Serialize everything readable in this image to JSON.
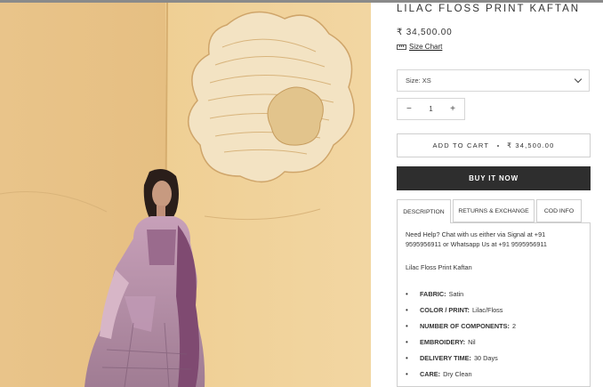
{
  "product": {
    "title": "LILAC FLOSS PRINT KAFTAN",
    "price": "₹ 34,500.00",
    "size_chart_label": "Size Chart"
  },
  "size_select": {
    "value": "Size: XS"
  },
  "quantity": {
    "minus": "−",
    "value": "1",
    "plus": "+"
  },
  "add_to_cart": {
    "label": "ADD TO CART",
    "price": "₹ 34,500.00"
  },
  "buy_now": {
    "label": "BUY IT NOW"
  },
  "tabs": [
    {
      "label": "DESCRIPTION"
    },
    {
      "label": "RETURNS & EXCHANGE"
    },
    {
      "label": "COD INFO"
    }
  ],
  "description": {
    "help_text": "Need Help? Chat with us either via Signal at +91 9595956911 or Whatsapp Us at +91 9595956911",
    "product_name": "Lilac Floss Print Kaftan",
    "specs": [
      {
        "label": "FABRIC:",
        "value": "Satin"
      },
      {
        "label": "COLOR / PRINT:",
        "value": "Lilac/Floss"
      },
      {
        "label": "NUMBER OF COMPONENTS:",
        "value": "2"
      },
      {
        "label": "EMBROIDERY:",
        "value": "Nil"
      },
      {
        "label": "DELIVERY TIME:",
        "value": "30 Days"
      },
      {
        "label": "CARE:",
        "value": "Dry Clean"
      }
    ]
  },
  "colors": {
    "wall": "#e9c58a",
    "buy_button": "#2e2e2e",
    "border": "#cfcfcf",
    "garment": "#b28aa8"
  }
}
